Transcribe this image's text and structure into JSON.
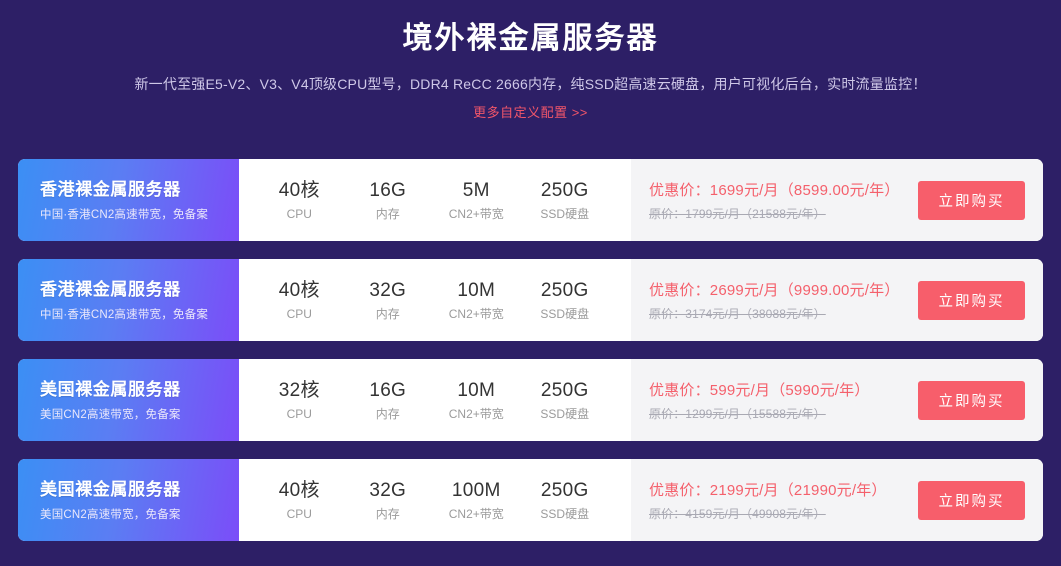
{
  "header": {
    "title": "境外裸金属服务器",
    "subtitle": "新一代至强E5-V2、V3、V4顶级CPU型号，DDR4 ReCC 2666内存，纯SSD超高速云硬盘，用户可视化后台，实时流量监控！",
    "more_link": "更多自定义配置 >>",
    "accent_color": "#f2566a",
    "background_color": "#2d1f66"
  },
  "spec_labels": {
    "cpu": "CPU",
    "memory": "内存",
    "bandwidth": "CN2+带宽",
    "disk": "SSD硬盘"
  },
  "buy_label": "立即购买",
  "cards": [
    {
      "name": "香港裸金属服务器",
      "desc": "中国·香港CN2高速带宽，免备案",
      "cpu": "40核",
      "memory": "16G",
      "bandwidth": "5M",
      "disk": "250G",
      "price_now": "优惠价：1699元/月（8599.00元/年）",
      "price_old": "原价：1799元/月（21588元/年）",
      "buy_label": "立即购买"
    },
    {
      "name": "香港裸金属服务器",
      "desc": "中国·香港CN2高速带宽，免备案",
      "cpu": "40核",
      "memory": "32G",
      "bandwidth": "10M",
      "disk": "250G",
      "price_now": "优惠价：2699元/月（9999.00元/年）",
      "price_old": "原价：3174元/月（38088元/年）",
      "buy_label": "立即购买"
    },
    {
      "name": "美国裸金属服务器",
      "desc": "美国CN2高速带宽，免备案",
      "cpu": "32核",
      "memory": "16G",
      "bandwidth": "10M",
      "disk": "250G",
      "price_now": "优惠价：599元/月（5990元/年）",
      "price_old": "原价：1299元/月（15588元/年）",
      "buy_label": "立即购买"
    },
    {
      "name": "美国裸金属服务器",
      "desc": "美国CN2高速带宽，免备案",
      "cpu": "40核",
      "memory": "32G",
      "bandwidth": "100M",
      "disk": "250G",
      "price_now": "优惠价：2199元/月（21990元/年）",
      "price_old": "原价：4159元/月（49908元/年）",
      "buy_label": "立即购买"
    }
  ]
}
